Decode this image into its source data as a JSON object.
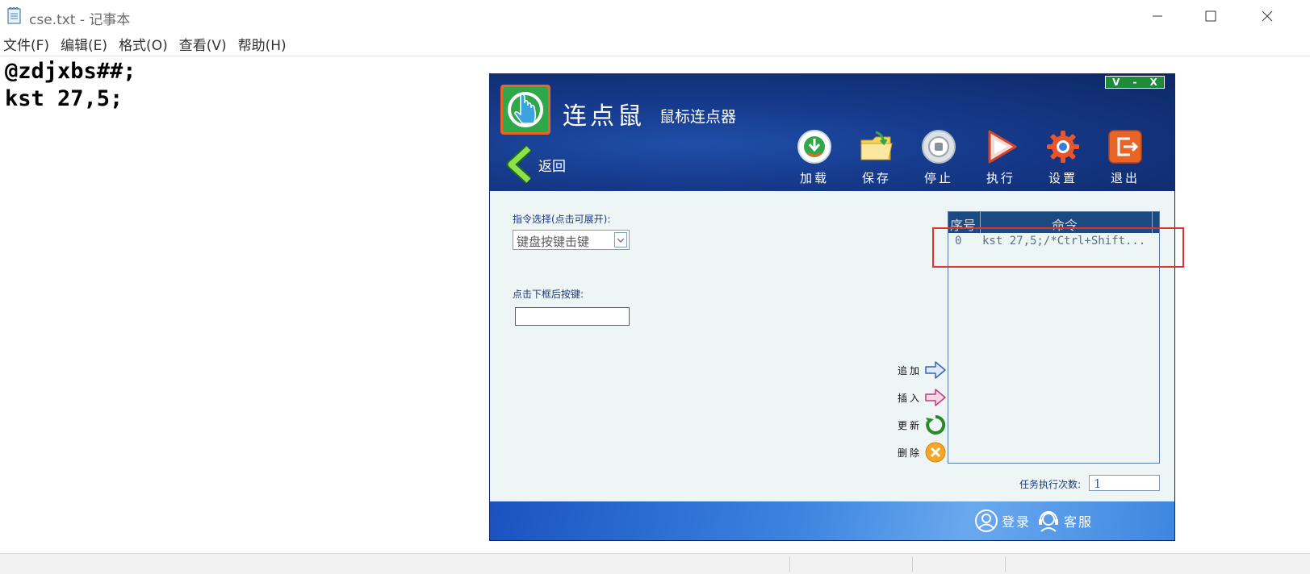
{
  "notepad": {
    "title": "cse.txt - 记事本",
    "menu": [
      "文件(F)",
      "编辑(E)",
      "格式(O)",
      "查看(V)",
      "帮助(H)"
    ],
    "lines": [
      "@zdjxbs##;",
      "kst 27,5;"
    ],
    "controls": {
      "minimize": "minimize-icon",
      "maximize": "maximize-icon",
      "close": "close-icon"
    }
  },
  "lds": {
    "app_name": "连点鼠",
    "subtitle": "鼠标连点器",
    "window_buttons": [
      "V",
      "-",
      "X"
    ],
    "back_label": "返回",
    "toolbar": [
      {
        "label": "加载",
        "icon": "load-icon"
      },
      {
        "label": "保存",
        "icon": "save-folder-icon"
      },
      {
        "label": "停止",
        "icon": "stop-icon"
      },
      {
        "label": "执行",
        "icon": "play-icon"
      },
      {
        "label": "设置",
        "icon": "gear-icon"
      },
      {
        "label": "退出",
        "icon": "exit-icon"
      }
    ],
    "cmd_select_label": "指令选择(点击可展开):",
    "cmd_select_value": "键盘按键击键",
    "key_input_label": "点击下框后按键:",
    "list": {
      "columns": [
        "序号",
        "命令"
      ],
      "rows": [
        {
          "index": "0",
          "command": "kst 27,5;/*Ctrl+Shift..."
        }
      ]
    },
    "actions": [
      {
        "label": "追加",
        "icon": "arrow-right-blue-icon"
      },
      {
        "label": "插入",
        "icon": "arrow-right-pink-icon"
      },
      {
        "label": "更新",
        "icon": "refresh-icon"
      },
      {
        "label": "删除",
        "icon": "delete-icon"
      }
    ],
    "count_label": "任务执行次数:",
    "count_value": "1",
    "footer": {
      "login": "登录",
      "service": "客服"
    },
    "colors": {
      "header_blue": "#163a8c",
      "accent_green": "#1d8b3a",
      "highlight_red": "#e03030"
    }
  }
}
